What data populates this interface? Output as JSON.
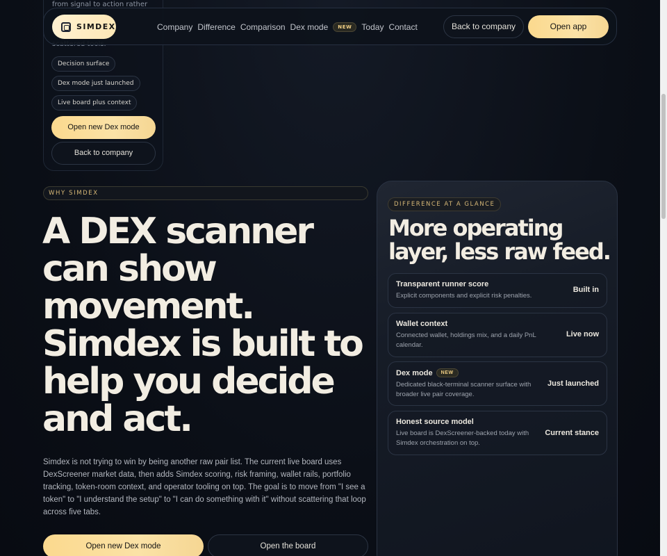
{
  "prev_card": {
    "frag1": "from signal to action rather",
    "frag2": "scattered tools.",
    "chips": [
      "Decision surface",
      "Dex mode just launched",
      "Live board plus context"
    ],
    "primary_button": "Open new Dex mode",
    "secondary_button": "Back to company"
  },
  "nav": {
    "logo": "SIMDEX",
    "links": [
      "Company",
      "Difference",
      "Comparison",
      "Dex mode",
      "Today",
      "Contact"
    ],
    "new_badge": "NEW",
    "back_button": "Back to company",
    "open_button": "Open app"
  },
  "hero": {
    "eyebrow": "WHY SIMDEX",
    "headline": "A DEX scanner can show movement. Simdex is built to help you decide and act.",
    "body": "Simdex is not trying to win by being another raw pair list. The current live board uses DexScreener market data, then adds Simdex scoring, risk framing, wallet rails, portfolio tracking, token-room context, and operator tooling on top. The goal is to move from \"I see a token\" to \"I understand the setup\" to \"I can do something with it\" without scattering that loop across five tabs.",
    "primary_button": "Open new Dex mode",
    "secondary_button": "Open the board"
  },
  "panel": {
    "eyebrow": "DIFFERENCE AT A GLANCE",
    "title": "More operating layer, less raw feed.",
    "rows": [
      {
        "title": "Transparent runner score",
        "desc": "Explicit components and explicit risk penalties.",
        "status": "Built in"
      },
      {
        "title": "Wallet context",
        "desc": "Connected wallet, holdings mix, and a daily PnL calendar.",
        "status": "Live now"
      },
      {
        "title": "Dex mode",
        "badge": "NEW",
        "desc": "Dedicated black-terminal scanner surface with broader live pair coverage.",
        "status": "Just launched"
      },
      {
        "title": "Honest source model",
        "desc": "Live board is DexScreener-backed today with Simdex orchestration on top.",
        "status": "Current stance"
      }
    ]
  },
  "colors": {
    "accent_gold": "#fbd98e",
    "background": "#0b0f17",
    "eyebrow_text": "#d7b877"
  }
}
